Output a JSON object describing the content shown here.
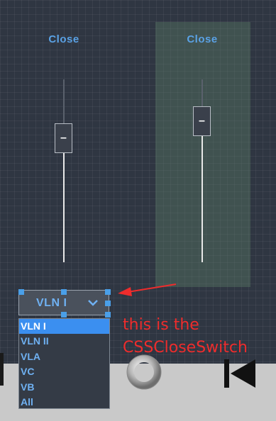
{
  "switches": [
    {
      "label": "Close",
      "thumb_glyph": "–",
      "level": 0.31
    },
    {
      "label": "Close",
      "thumb_glyph": "–",
      "level": 0.16
    }
  ],
  "select": {
    "value": "VLN I",
    "options": [
      "VLN I",
      "VLN II",
      "VLA",
      "VC",
      "VB",
      "All"
    ],
    "selected_index": 0
  },
  "annotation": {
    "line1": "this is the",
    "line2": "CSSCloseSwitch",
    "color": "#ee2c2c"
  },
  "colors": {
    "background": "#2f3642",
    "accent": "#5aa2e6",
    "selected_option": "#3b8ff0",
    "bottom_strip": "#c9c9c9"
  },
  "icons": {
    "knob": "ring-knob-icon",
    "skip_back": "skip-back-icon",
    "dropdown": "chevron-down-icon",
    "pointer": "red-arrow-icon"
  }
}
